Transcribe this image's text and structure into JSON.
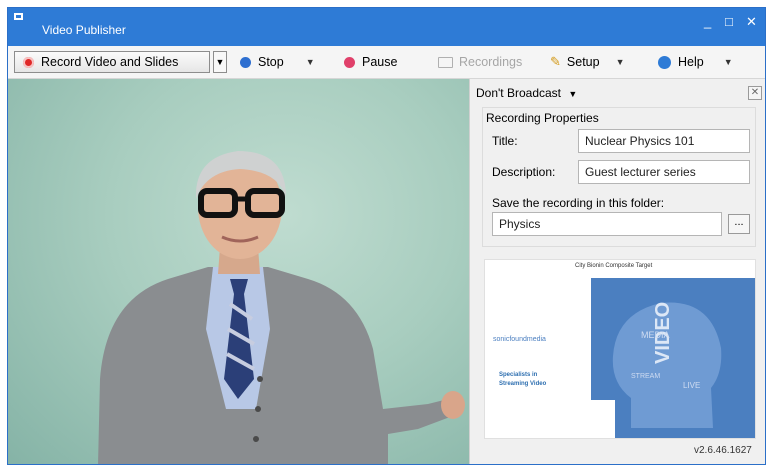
{
  "window": {
    "title": "Video Publisher",
    "minimize": "_",
    "maximize": "□",
    "close": "✕"
  },
  "toolbar": {
    "record": "Record Video and Slides",
    "stop": "Stop",
    "pause": "Pause",
    "recordings": "Recordings",
    "setup": "Setup",
    "help": "Help"
  },
  "panel": {
    "broadcast": "Don't Broadcast",
    "section_title": "Recording Properties",
    "title_label": "Title:",
    "title_value": "Nuclear Physics 101",
    "description_label": "Description:",
    "description_value": "Guest lecturer series",
    "folder_label": "Save the recording in this folder:",
    "folder_value": "Physics",
    "browse": "..."
  },
  "slide": {
    "header": "City Bionin Composite Target",
    "logo": "sonicfoundmedia",
    "tagline_1": "Specialists in",
    "tagline_2": "Streaming Video"
  },
  "version": "v2.6.46.1627",
  "colors": {
    "titlebar": "#2e7bd6",
    "record_red": "#e02828",
    "slide_blue": "#4b7fc0"
  }
}
